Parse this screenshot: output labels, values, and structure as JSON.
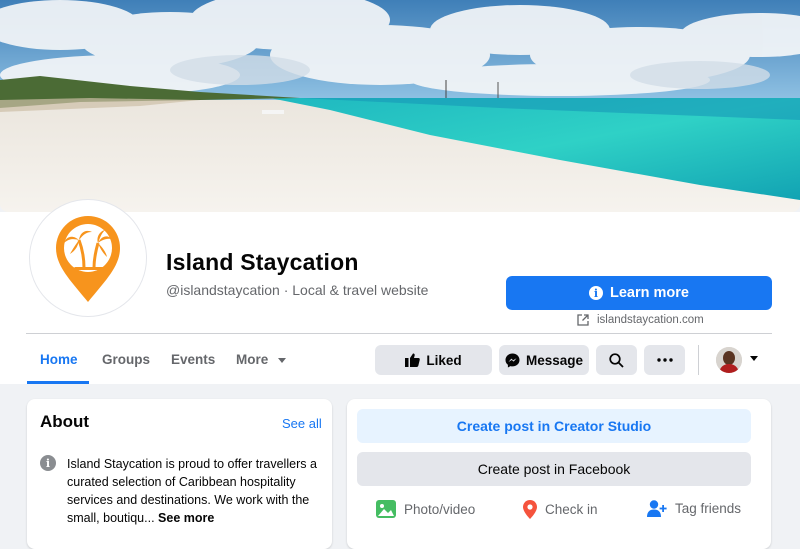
{
  "page": {
    "name": "Island Staycation",
    "handle": "@islandstaycation",
    "category": "Local & travel website",
    "meta_line": "@islandstaycation · Local & travel website"
  },
  "cta": {
    "label": "Learn more",
    "website": "islandstaycation.com"
  },
  "tabs": [
    {
      "label": "Home",
      "active": true
    },
    {
      "label": "Groups"
    },
    {
      "label": "Events"
    },
    {
      "label": "More"
    }
  ],
  "actions": {
    "liked": "Liked",
    "message": "Message"
  },
  "about": {
    "title": "About",
    "see_all": "See all",
    "text": "Island Staycation is proud to offer travellers a curated selection of Caribbean hospitality services and destinations. We work with the small, boutiqu...",
    "see_more": "See more"
  },
  "composer": {
    "creator_studio": "Create post in Creator Studio",
    "facebook": "Create post in Facebook",
    "photo_video": "Photo/video",
    "check_in": "Check in",
    "tag_friends": "Tag friends"
  },
  "colors": {
    "accent": "#1877f2",
    "brand_orange": "#f7941d",
    "page_bg": "#f0f2f5"
  },
  "icons": [
    "info-icon",
    "external-link-icon",
    "like-icon",
    "messenger-icon",
    "search-icon",
    "more-dots-icon",
    "photo-icon",
    "location-pin-icon",
    "tag-friends-icon",
    "palm-tree-logo"
  ]
}
